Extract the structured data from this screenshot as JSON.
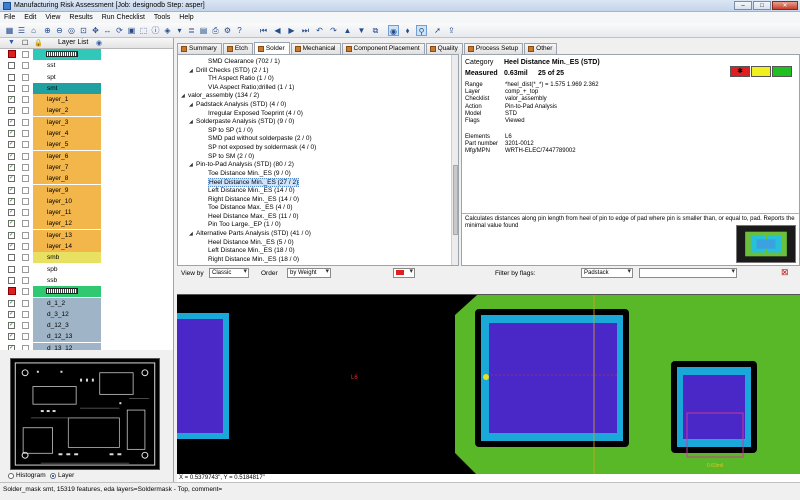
{
  "window": {
    "title": "Manufacturing Risk Assessment [Job: designodb Step: asper]"
  },
  "menu": [
    "File",
    "Edit",
    "View",
    "Results",
    "Run Checklist",
    "Tools",
    "Help"
  ],
  "layer_list": {
    "header": "Layer List",
    "rows": [
      {
        "label": "",
        "color": "#30c8b8",
        "checked": true,
        "marked": true,
        "thumb": true
      },
      {
        "label": "sst",
        "color": "#ffffff",
        "checked": false
      },
      {
        "label": "spt",
        "color": "#ffffff",
        "checked": false
      },
      {
        "label": "smt",
        "color": "#20a0a0",
        "checked": false
      },
      {
        "label": "layer_1",
        "color": "#f2b64a",
        "checked": true
      },
      {
        "label": "layer_2",
        "color": "#f2b64a",
        "checked": true
      },
      {
        "label": "layer_3",
        "color": "#f2b64a",
        "checked": true
      },
      {
        "label": "layer_4",
        "color": "#f2b64a",
        "checked": true
      },
      {
        "label": "layer_5",
        "color": "#f2b64a",
        "checked": true
      },
      {
        "label": "layer_6",
        "color": "#f2b64a",
        "checked": true
      },
      {
        "label": "layer_7",
        "color": "#f2b64a",
        "checked": true
      },
      {
        "label": "layer_8",
        "color": "#f2b64a",
        "checked": true
      },
      {
        "label": "layer_9",
        "color": "#f2b64a",
        "checked": true
      },
      {
        "label": "layer_10",
        "color": "#f2b64a",
        "checked": true
      },
      {
        "label": "layer_11",
        "color": "#f2b64a",
        "checked": true
      },
      {
        "label": "layer_12",
        "color": "#f2b64a",
        "checked": true
      },
      {
        "label": "layer_13",
        "color": "#f2b64a",
        "checked": true
      },
      {
        "label": "layer_14",
        "color": "#f2b64a",
        "checked": true
      },
      {
        "label": "smb",
        "color": "#e8e060",
        "checked": false
      },
      {
        "label": "spb",
        "color": "#ffffff",
        "checked": false
      },
      {
        "label": "ssb",
        "color": "#ffffff",
        "checked": false
      },
      {
        "label": "",
        "color": "#30c870",
        "checked": true,
        "marked": true,
        "thumb": true
      },
      {
        "label": "d_1_2",
        "color": "#9fb4c6",
        "checked": true
      },
      {
        "label": "d_3_12",
        "color": "#9fb4c6",
        "checked": true
      },
      {
        "label": "d_12_3",
        "color": "#9fb4c6",
        "checked": true
      },
      {
        "label": "d_12_13",
        "color": "#9fb4c6",
        "checked": true
      },
      {
        "label": "d_13_12",
        "color": "#9fb4c6",
        "checked": true
      }
    ]
  },
  "minimap": {
    "opt_histogram": "Histogram",
    "opt_layer": "Layer",
    "selected": "Layer"
  },
  "tabs": [
    "Summary",
    "Etch",
    "Solder",
    "Mechanical",
    "Component Placement",
    "Quality",
    "Process Setup",
    "Other"
  ],
  "active_tab": "Solder",
  "tree": [
    {
      "text": "SMD Clearance (702 / 1)",
      "indent": 2
    },
    {
      "text": "Drill Checks (STD) (2 / 1)",
      "indent": 1,
      "expand": true
    },
    {
      "text": "TH Aspect Ratio (1 / 0)",
      "indent": 2
    },
    {
      "text": "VIA Aspect Ratio;drilled (1 / 1)",
      "indent": 2
    },
    {
      "text": "valor_assembly (134 / 2)",
      "indent": 0,
      "expand": true
    },
    {
      "text": "Padstack Analysis (STD) (4 / 0)",
      "indent": 1,
      "expand": true
    },
    {
      "text": "Irregular Exposed Toeprint (4 / 0)",
      "indent": 2
    },
    {
      "text": "Solderpaste Analysis (STD) (9 / 0)",
      "indent": 1,
      "expand": true
    },
    {
      "text": "SP to SP (1 / 0)",
      "indent": 2
    },
    {
      "text": "SMD pad without solderpaste (2 / 0)",
      "indent": 2
    },
    {
      "text": "SP not exposed by soldermask (4 / 0)",
      "indent": 2
    },
    {
      "text": "SP to SM (2 / 0)",
      "indent": 2
    },
    {
      "text": "Pin-to-Pad Analysis (STD) (80 / 2)",
      "indent": 1,
      "expand": true
    },
    {
      "text": "Toe Distance Min._ES (9 / 0)",
      "indent": 2
    },
    {
      "text": "Heel Distance Min._ES (27 / 2)",
      "indent": 2,
      "selected": true
    },
    {
      "text": "Left Distance Min._ES (14 / 0)",
      "indent": 2
    },
    {
      "text": "Right Distance Min._ES (14 / 0)",
      "indent": 2
    },
    {
      "text": "Toe Distance Max._ES (4 / 0)",
      "indent": 2
    },
    {
      "text": "Heel Distance Max._ES (11 / 0)",
      "indent": 2
    },
    {
      "text": "Pin Too Large._EP (1 / 0)",
      "indent": 2
    },
    {
      "text": "Alternative Parts Analysis (STD) (41 / 0)",
      "indent": 1,
      "expand": true
    },
    {
      "text": "Heel Distance Min._ES (5 / 0)",
      "indent": 2
    },
    {
      "text": "Left Distance Min._ES (18 / 0)",
      "indent": 2
    },
    {
      "text": "Right Distance Min._ES (18 / 0)",
      "indent": 2
    }
  ],
  "detail": {
    "category_label": "Category",
    "category_value": "Heel Distance Min._ES  (STD)",
    "measured_label": "Measured",
    "measured_value": "0.63mil",
    "count": "25 of 25",
    "severity_colors": [
      "#e02020",
      "#f0f020",
      "#20c020"
    ],
    "fields": [
      {
        "k": "Range",
        "v": "*heel_dist(*_*) = 1.575 1.969 2.362"
      },
      {
        "k": "Layer",
        "v": "comp_+_top"
      },
      {
        "k": "Checklist",
        "v": "valor_assembly"
      },
      {
        "k": "Action",
        "v": "Pin-to-Pad Analysis"
      },
      {
        "k": "Model",
        "v": "STD"
      },
      {
        "k": "Flags",
        "v": "Viewed"
      }
    ],
    "fields2": [
      {
        "k": "Elements",
        "v": "L6"
      },
      {
        "k": "Part number",
        "v": "3201-0012"
      },
      {
        "k": "Mfg/MPN",
        "v": "WRTH-ELEC/7447789002"
      }
    ],
    "description": "Calculates distances along pin length from heel of pin to edge of pad where pin is smaller than, or equal to, pad. Reports the minimal value found"
  },
  "filters": {
    "view_by_label": "View by",
    "view_by_value": "Classic",
    "order_label": "Order",
    "order_value": "by Weight",
    "flags_label": "Filter by flags:",
    "flags_value": "Padstack",
    "extra_value": ""
  },
  "canvas": {
    "label_l6": "L6",
    "bottom_text": "0.63mil"
  },
  "coords": "X = 0.5379743\", Y = 0.5184817\"",
  "status": "Solder_mask smt, 15319 features, eda layers=Soldermask - Top, comment="
}
